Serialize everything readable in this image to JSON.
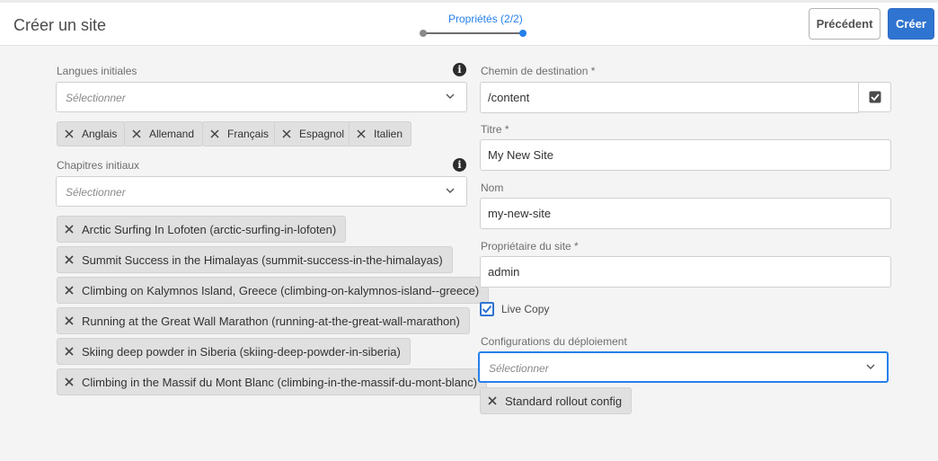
{
  "header": {
    "title": "Créer un site",
    "wizard_step": "Propriétés (2/2)",
    "prev_label": "Précédent",
    "create_label": "Créer"
  },
  "left": {
    "languages": {
      "label": "Langues initiales",
      "placeholder": "Sélectionner",
      "tags": [
        "Anglais",
        "Allemand",
        "Français",
        "Espagnol",
        "Italien"
      ]
    },
    "chapters": {
      "label": "Chapitres initiaux",
      "placeholder": "Sélectionner",
      "tags": [
        "Arctic Surfing In Lofoten (arctic-surfing-in-lofoten)",
        "Summit Success in the Himalayas (summit-success-in-the-himalayas)",
        "Climbing on Kalymnos Island, Greece (climbing-on-kalymnos-island--greece)",
        "Running at the Great Wall Marathon (running-at-the-great-wall-marathon)",
        "Skiing deep powder in Siberia (skiing-deep-powder-in-siberia)",
        "Climbing in the Massif du Mont Blanc (climbing-in-the-massif-du-mont-blanc)"
      ]
    }
  },
  "right": {
    "destination": {
      "label": "Chemin de destination *",
      "value": "/content"
    },
    "title": {
      "label": "Titre *",
      "value": "My New Site"
    },
    "name": {
      "label": "Nom",
      "value": "my-new-site"
    },
    "owner": {
      "label": "Propriétaire du site *",
      "value": "admin"
    },
    "live_copy": {
      "label": "Live Copy",
      "checked": true
    },
    "rollout": {
      "label": "Configurations du déploiement",
      "placeholder": "Sélectionner",
      "tags": [
        "Standard rollout config"
      ]
    }
  },
  "colors": {
    "accent": "#2f74d0",
    "wizard_active": "#2680eb",
    "focus_border": "#2680eb"
  }
}
